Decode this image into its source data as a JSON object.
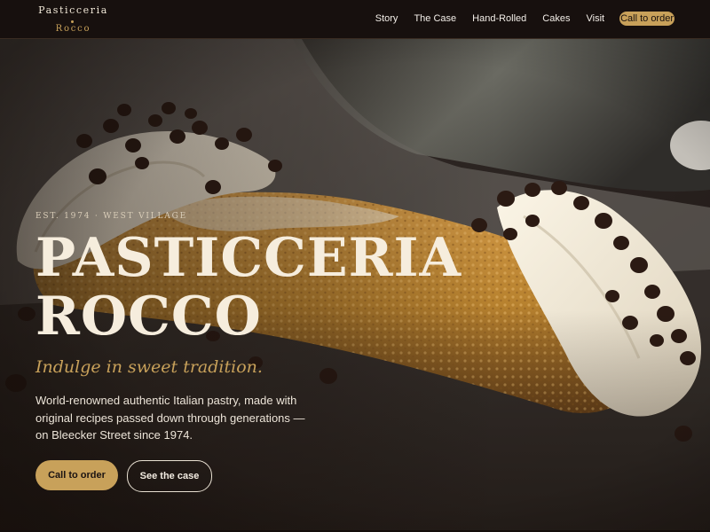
{
  "brand": {
    "name_top": "Pasticceria",
    "name_bottom": "Rocco"
  },
  "nav": {
    "links": [
      "Story",
      "The Case",
      "Hand-Rolled",
      "Cakes",
      "Visit"
    ],
    "cta": "Call to order"
  },
  "hero": {
    "eyebrow": "EST. 1974 · WEST VILLAGE",
    "title_line1": "PASTICCERIA",
    "title_line2": "ROCCO",
    "tagline": "Indulge in sweet tradition.",
    "description": "World-renowned authentic Italian pastry, made with original recipes passed down through generations — on Bleecker Street since 1974.",
    "primary_button": "Call to order",
    "secondary_button": "See the case"
  },
  "colors": {
    "accent": "#c8a15a",
    "header_bg": "#17100e",
    "cream": "#f6eddd",
    "pastry_shell": "#b8822f"
  }
}
